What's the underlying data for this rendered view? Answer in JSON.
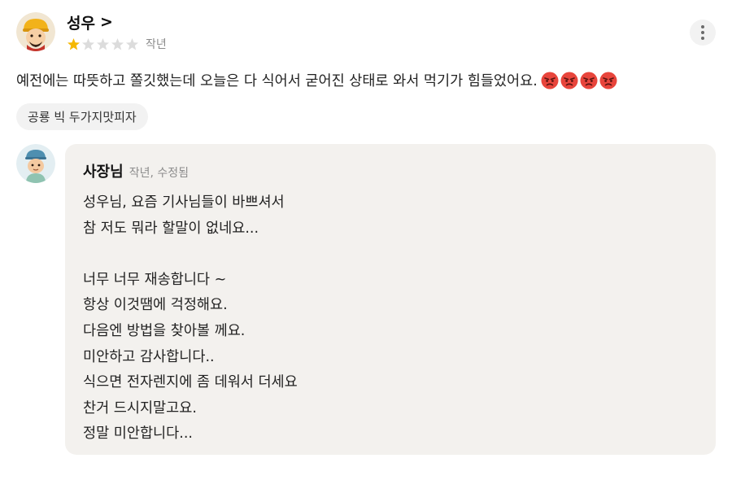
{
  "review": {
    "user_name": "성우",
    "profile_chevron": ">",
    "rating": 1,
    "max_rating": 5,
    "date": "작년",
    "text": "예전에는 따뜻하고 쫄깃했는데 오늘은 다 식어서 굳어진 상태로 와서 먹기가 힘들었어요.",
    "emoji_icons": [
      "angry-face-icon",
      "angry-face-icon",
      "angry-face-icon",
      "angry-face-icon"
    ],
    "menu_tag": "공룡 빅 두가지맛피자"
  },
  "reply": {
    "owner_name": "사장님",
    "meta": "작년, 수정됨",
    "lines": [
      "성우님, 요즘 기사님들이 바쁘셔서",
      "참 저도 뭐라 할말이 없네요...",
      "",
      "너무 너무 재송합니다 ~",
      "항상 이것땜에 걱정해요.",
      "다음엔 방법을 찾아볼 께요.",
      "미안하고 감사합니다..",
      "식으면 전자렌지에 좀 데워서 더세요",
      "찬거 드시지말고요.",
      "정말 미안합니다..."
    ]
  },
  "colors": {
    "star_filled": "#f5b800",
    "star_empty": "#dcdcdc",
    "reply_background": "#f3f1ee",
    "tag_background": "#f2f2f2",
    "meta_text": "#8c8c8c"
  }
}
